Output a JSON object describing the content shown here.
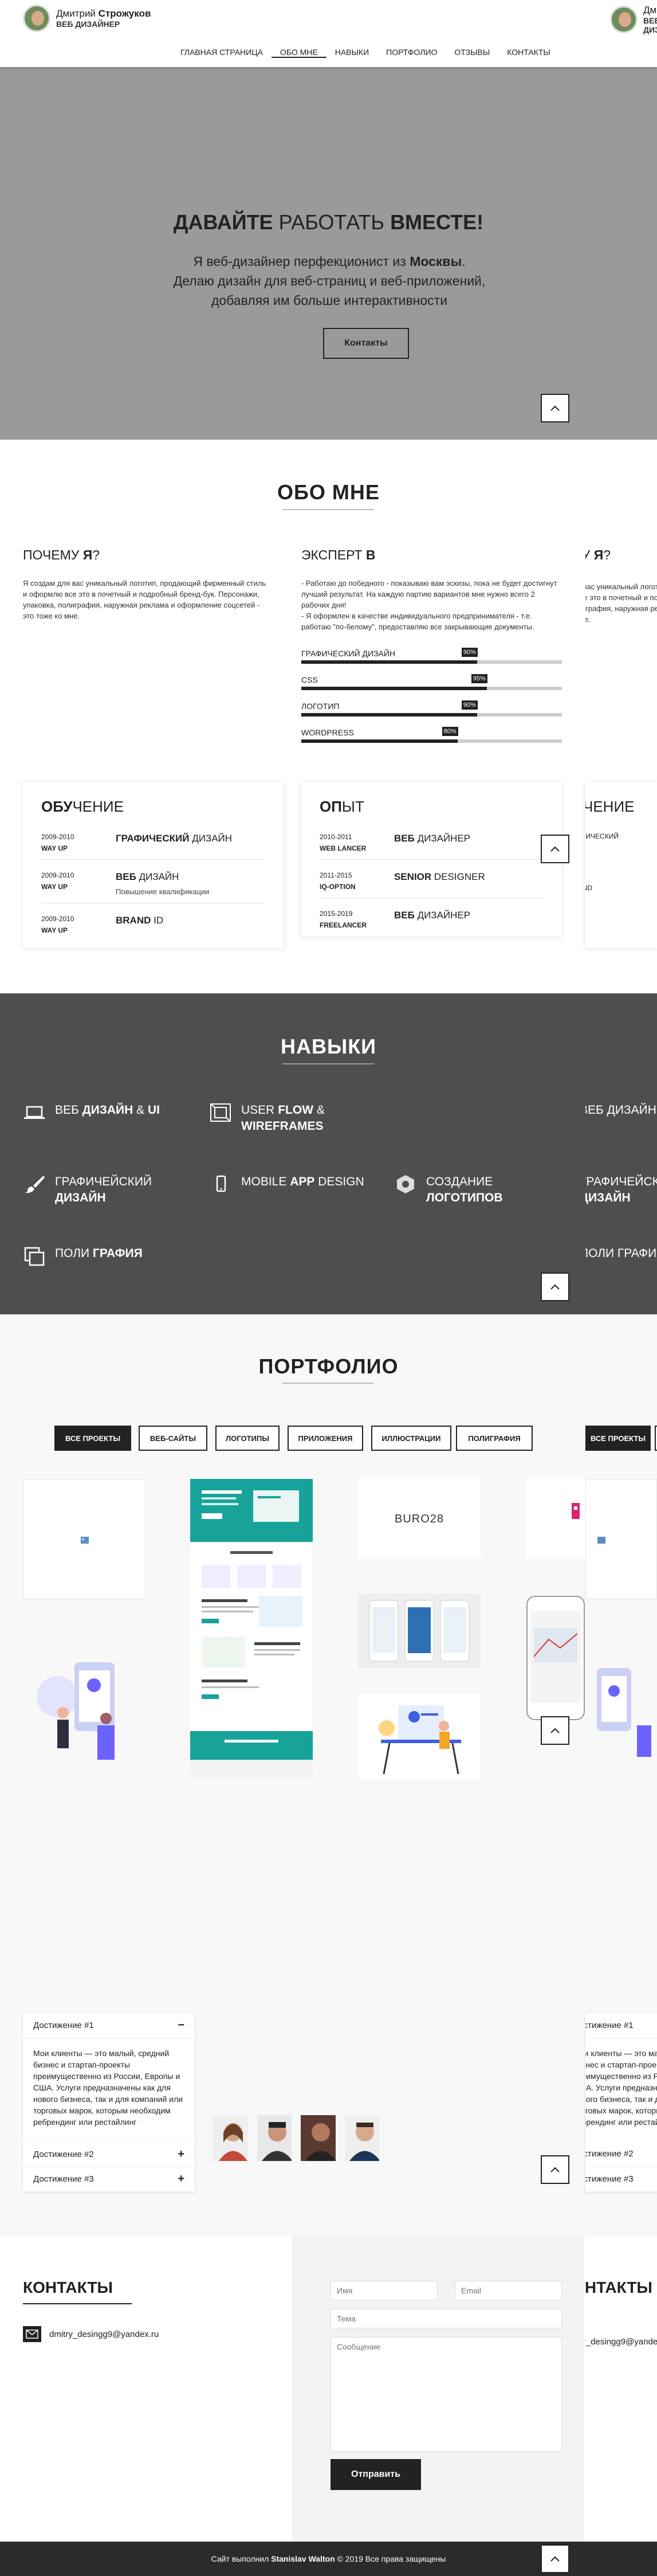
{
  "header": {
    "first_name": "Дмитрий",
    "last_name": "Строжуков",
    "role": "ВЕБ ДИЗАЙНЕР",
    "nav": [
      "ГЛАВНАЯ СТРАНИЦА",
      "ОБО МНЕ",
      "НАВЫКИ",
      "ПОРТФОЛИО",
      "ОТЗЫВЫ",
      "КОНТАКТЫ"
    ],
    "active_nav": "ОБО МНЕ"
  },
  "hero": {
    "title_bold1": "ДАВАЙТЕ",
    "title_light": "РАБОТАТЬ",
    "title_bold2": "ВМЕСТЕ!",
    "sub_pre": "Я веб-дизайнер перфекционист из",
    "sub_city": "Москвы",
    "sub_post": ". Делаю дизайн для веб-страниц и веб-приложений, добавляя им больше интерактивности",
    "button": "Контакты"
  },
  "about": {
    "title": "ОБО МНЕ",
    "why_light": "ПОЧЕМУ",
    "why_bold": "Я",
    "why_q": "?",
    "why_text": "Я создам для вас уникальный логотип, продающий фирменный стиль и оформлю все это в почетный и подробный бренд-бук. Персонажи, упаковка, полиграфия, наружная реклама и оформление соцсетей - это тоже ко мне.",
    "expert_light": "ЭКСПЕРТ",
    "expert_bold": "В",
    "expert_text1": "- Работаю до победного - показываю вам эскизы, пока не будет достигнут лучший результат. На каждую партию вариантов мне нужно всего 2 рабочих дня!",
    "expert_text2": "- Я оформлен в качестве индивидуального предпринимателя - т.е. работаю \"по-белому\", предоставляю все закрывающие документы.",
    "skills": [
      {
        "label": "ГРАФИЧЕСКИЙ ДИЗАЙН",
        "value": 90,
        "pct": "90%"
      },
      {
        "label": "CSS",
        "value": 95,
        "pct": "95%"
      },
      {
        "label": "ЛОГОТИП",
        "value": 90,
        "pct": "90%"
      },
      {
        "label": "WORDPRESS",
        "value": 80,
        "pct": "80%"
      }
    ],
    "education_bold": "ОБУ",
    "education_light": "ЧЕНИЕ",
    "education": [
      {
        "years": "2009-2010",
        "place": "WAY UP",
        "title_bold": "ГРАФИЧЕСКИЙ",
        "title_light": "ДИЗАЙН",
        "desc": ""
      },
      {
        "years": "2009-2010",
        "place": "WAY UP",
        "title_bold": "ВЕБ",
        "title_light": "ДИЗАЙН",
        "desc": "Повышение квалификации"
      },
      {
        "years": "2009-2010",
        "place": "WAY UP",
        "title_bold": "BRAND",
        "title_light": "ID",
        "desc": ""
      }
    ],
    "experience_bold": "ОП",
    "experience_light": "ЫТ",
    "experience": [
      {
        "years": "2010-2011",
        "place": "WEB LANCER",
        "title_bold": "ВЕБ",
        "title_light": "ДИЗАЙНЕР"
      },
      {
        "years": "2011-2015",
        "place": "IQ-OPTION",
        "title_bold": "SENIOR",
        "title_light": "DESIGNER"
      },
      {
        "years": "2015-2019",
        "place": "FREELANCER",
        "title_bold": "ВЕБ",
        "title_light": "ДИЗАЙНЕР"
      }
    ]
  },
  "skills": {
    "title": "НАВЫКИ",
    "items": [
      {
        "light": "ВЕБ",
        "bold": "ДИЗАЙН",
        "sep": " & ",
        "bold2": "UI",
        "icon": "laptop-icon"
      },
      {
        "light": "USER",
        "bold": "FLOW",
        "sep": " & ",
        "bold2": "WIREFRAMES",
        "icon": "wireframe-icon"
      },
      {
        "light": "ГРАФИЧЕЙСКИЙ",
        "bold": "ДИЗАЙН",
        "sep": "",
        "bold2": "",
        "icon": "brush-icon"
      },
      {
        "light": "MOBILE",
        "bold": "APP",
        "sep": " ",
        "bold2": "DESIGN",
        "icon": "mobile-icon"
      },
      {
        "light": "СОЗДАНИЕ",
        "bold": "ЛОГОТИПОВ",
        "sep": "",
        "bold2": "",
        "icon": "hexagon-icon"
      },
      {
        "light": "ПОЛИ",
        "bold": "ГРАФИЯ",
        "sep": "",
        "bold2": "",
        "icon": "print-icon"
      }
    ],
    "ghost_1": "ВЕБ ДИЗАЙН & UI",
    "ghost_2a": "ГРАФИЧЕЙСКИЙ",
    "ghost_2b": "ДИЗАЙН",
    "ghost_3": "ПОЛИ ГРАФИЯ"
  },
  "portfolio": {
    "title": "ПОРТФОЛИО",
    "filters": [
      "ВСЕ ПРОЕКТЫ",
      "ВЕБ-САЙТЫ",
      "ЛОГОТИПЫ",
      "ПРИЛОЖЕНИЯ",
      "ИЛЛЮСТРАЦИИ",
      "ПОЛИГРАФИЯ"
    ],
    "active_filter": "ВСЕ ПРОЕКТЫ",
    "logo_text": "BURO28"
  },
  "achievements": {
    "items": [
      "Достижение #1",
      "Достижение #2",
      "Достижение #3"
    ],
    "open_text": "Мои клиенты — это малый, средний бизнес и стартап-проекты преимущественно из России, Европы и США. Услуги предназначены как для нового бизнеса, так и для компаний или торговых марок, которым необходим ребрендинг или рестайлинг"
  },
  "contacts": {
    "title": "КОНТАКТЫ",
    "email": "dmitry_desingg9@yandex.ru",
    "placeholders": {
      "name": "Имя",
      "email": "Email",
      "subject": "Тема",
      "message": "Сообщение"
    },
    "send": "Отправить"
  },
  "footer": {
    "pre": "Сайт выполнил",
    "author": "Stanislav Walton",
    "post": "© 2019 Все права защищены"
  },
  "colors": {
    "hero_bg": "#9a9a9a",
    "skills_bg": "#4e4e4e",
    "accent": "#222222",
    "teal": "#1aa39a"
  }
}
